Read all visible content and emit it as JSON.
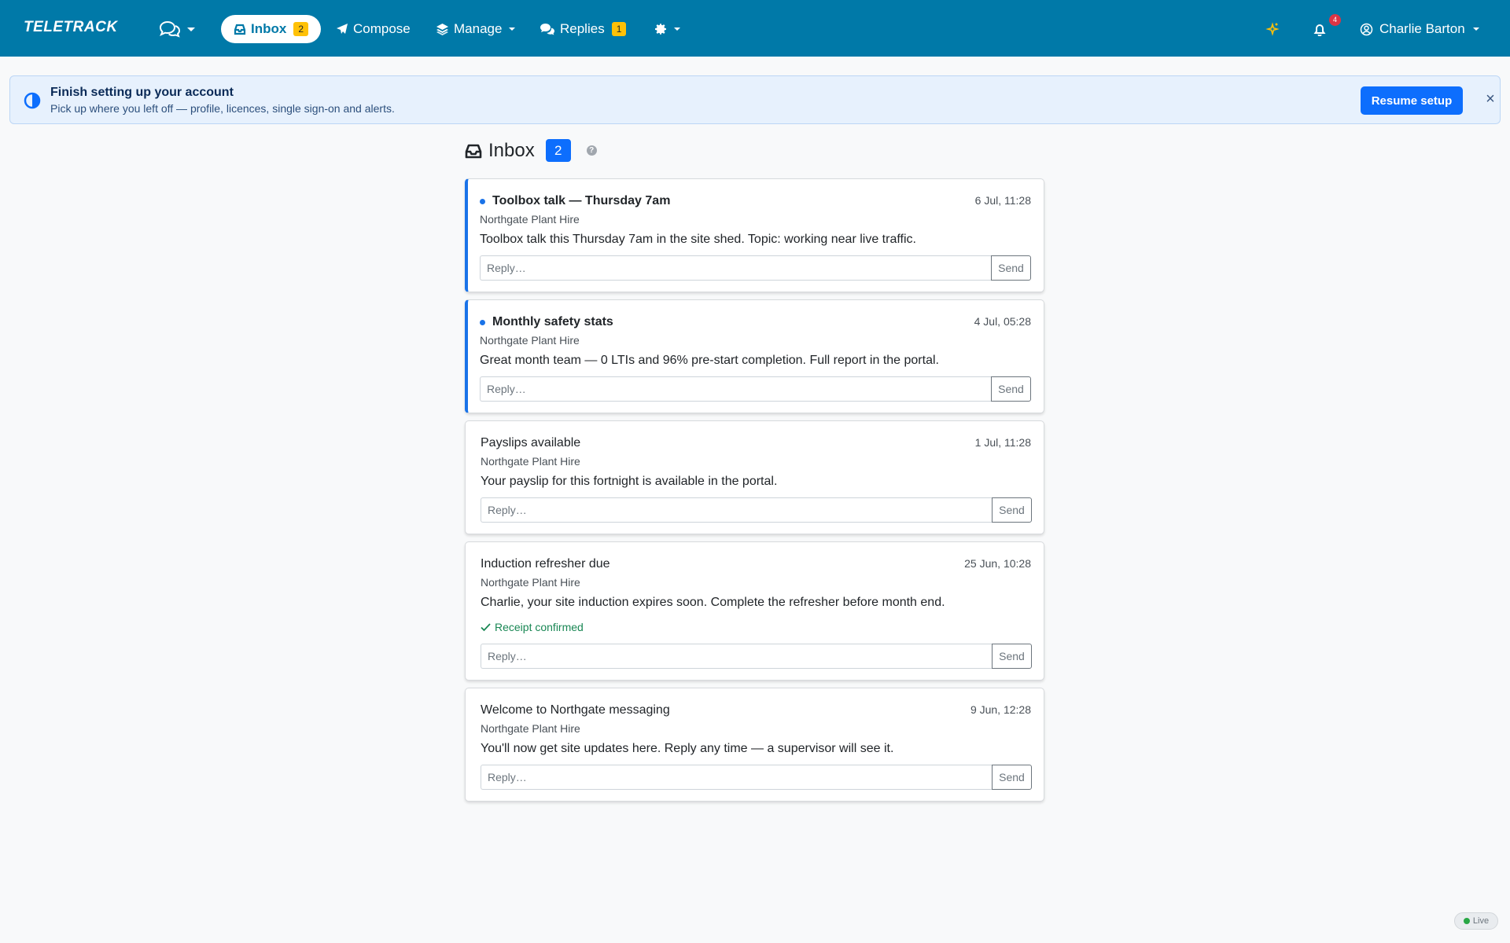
{
  "app": {
    "brand": "TELETRACK"
  },
  "nav": {
    "inbox_label": "Inbox",
    "inbox_badge": "2",
    "compose_label": "Compose",
    "manage_label": "Manage",
    "replies_label": "Replies",
    "replies_badge": "1",
    "notifications_count": "4",
    "user_name": "Charlie Barton"
  },
  "setup": {
    "title": "Finish setting up your account",
    "subtitle": "Pick up where you left off — profile, licences, single sign-on and alerts.",
    "button": "Resume setup",
    "close": "×"
  },
  "inbox": {
    "title": "Inbox",
    "count": "2",
    "help": "?",
    "reply_placeholder": "Reply…",
    "send_label": "Send",
    "messages": [
      {
        "title": "Toolbox talk — Thursday 7am",
        "time": "6 Jul, 11:28",
        "from": "Northgate Plant Hire",
        "body": "Toolbox talk this Thursday 7am in the site shed. Topic: working near live traffic.",
        "unread": true
      },
      {
        "title": "Monthly safety stats",
        "time": "4 Jul, 05:28",
        "from": "Northgate Plant Hire",
        "body": "Great month team — 0 LTIs and 96% pre-start completion. Full report in the portal.",
        "unread": true
      },
      {
        "title": "Payslips available",
        "time": "1 Jul, 11:28",
        "from": "Northgate Plant Hire",
        "body": "Your payslip for this fortnight is available in the portal.",
        "unread": false
      },
      {
        "title": "Induction refresher due",
        "time": "25 Jun, 10:28",
        "from": "Northgate Plant Hire",
        "body": "Charlie, your site induction expires soon. Complete the refresher before month end.",
        "unread": false,
        "receipt": "Receipt confirmed"
      },
      {
        "title": "Welcome to Northgate messaging",
        "time": "9 Jun, 12:28",
        "from": "Northgate Plant Hire",
        "body": "You'll now get site updates here. Reply any time — a supervisor will see it.",
        "unread": false
      }
    ]
  },
  "status": {
    "live_label": "Live"
  },
  "colors": {
    "navbar": "#0079a8",
    "accent": "#0d6efd",
    "unread": "#1a73e8",
    "badge": "#ffc107",
    "success": "#198754"
  }
}
